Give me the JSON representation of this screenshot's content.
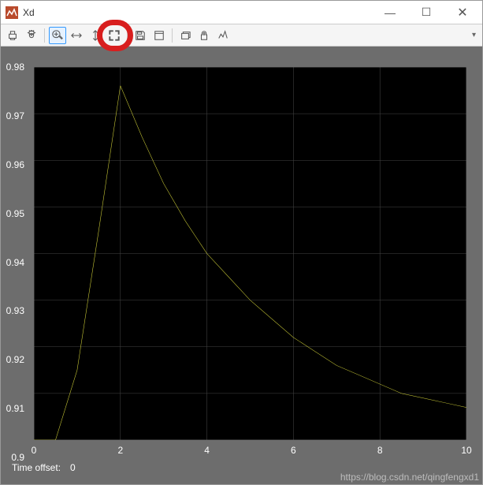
{
  "window": {
    "title": "Xd",
    "minimize": "—",
    "maximize": "☐",
    "close": "✕"
  },
  "toolbar": {
    "items": [
      {
        "name": "print-icon"
      },
      {
        "name": "parameters-icon"
      },
      {
        "sep": true
      },
      {
        "name": "zoom-in-icon",
        "selected": true
      },
      {
        "name": "zoom-x-icon"
      },
      {
        "name": "zoom-y-icon"
      },
      {
        "name": "autoscale-icon"
      },
      {
        "sep": true
      },
      {
        "name": "save-icon"
      },
      {
        "name": "restore-icon"
      },
      {
        "sep": true
      },
      {
        "name": "float-icon"
      },
      {
        "name": "lock-icon"
      },
      {
        "name": "signal-icon"
      }
    ]
  },
  "status": {
    "label": "Time offset:",
    "value": "0"
  },
  "watermark": "https://blog.csdn.net/qingfengxd1",
  "chart_data": {
    "type": "line",
    "xlabel": "",
    "ylabel": "",
    "xlim": [
      0,
      10
    ],
    "ylim": [
      0.9,
      0.98
    ],
    "xticks": [
      0,
      2,
      4,
      6,
      8,
      10
    ],
    "yticks": [
      0.9,
      0.91,
      0.92,
      0.93,
      0.94,
      0.95,
      0.96,
      0.97,
      0.98
    ],
    "x": [
      0,
      0.5,
      1.0,
      1.5,
      2.0,
      2.5,
      3.0,
      3.5,
      4.0,
      4.5,
      5.0,
      5.5,
      6.0,
      6.5,
      7.0,
      7.5,
      8.0,
      8.5,
      9.0,
      9.5,
      10.0
    ],
    "y": [
      0.9,
      0.9,
      0.915,
      0.945,
      0.976,
      0.965,
      0.955,
      0.947,
      0.94,
      0.935,
      0.93,
      0.926,
      0.922,
      0.919,
      0.916,
      0.914,
      0.912,
      0.91,
      0.909,
      0.908,
      0.907
    ]
  }
}
